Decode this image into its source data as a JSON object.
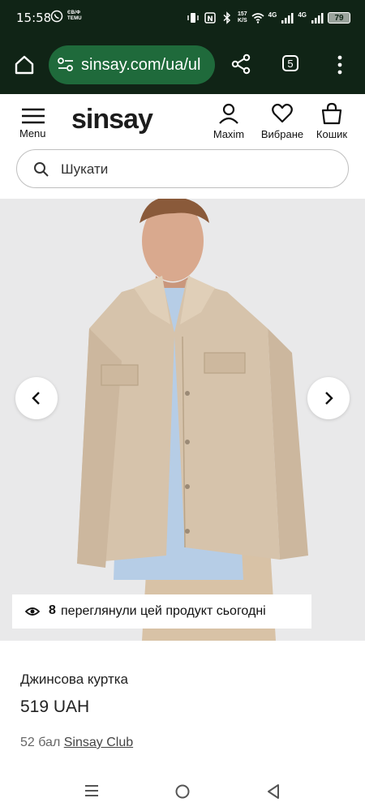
{
  "status_bar": {
    "time": "15:58",
    "temu_line1": "ЄВ/Ф",
    "temu_line2": "TEMU",
    "speed_value": "157",
    "speed_unit": "K/S",
    "net1": "4G",
    "net2": "4G",
    "battery": "79"
  },
  "browser": {
    "url": "sinsay.com/ua/ul",
    "tab_count": "5"
  },
  "header": {
    "menu_label": "Menu",
    "logo": "sinsay",
    "account_label": "Maxim",
    "wishlist_label": "Вибране",
    "cart_label": "Кошик"
  },
  "search": {
    "placeholder": "Шукати"
  },
  "gallery": {
    "views_count": "8",
    "views_text": "переглянули цей продукт сьогодні"
  },
  "product": {
    "title": "Джинсова куртка",
    "price": "519 UAH",
    "points_prefix": "52 бал",
    "club_link": "Sinsay Club"
  },
  "icons": {
    "home": "home-icon",
    "site_settings": "tune-icon",
    "share": "share-icon",
    "tabs": "tabs-icon",
    "more": "more-vert-icon",
    "menu": "hamburger-icon",
    "account": "user-icon",
    "wishlist": "heart-icon",
    "cart": "bag-icon",
    "search": "search-icon",
    "eye": "eye-icon",
    "prev": "chevron-left-icon",
    "next": "chevron-right-icon"
  },
  "colors": {
    "status_bg": "#102416",
    "url_pill": "#1f6a3b",
    "photo_bg": "#e9e9ea",
    "jacket": "#d6c3ab"
  }
}
